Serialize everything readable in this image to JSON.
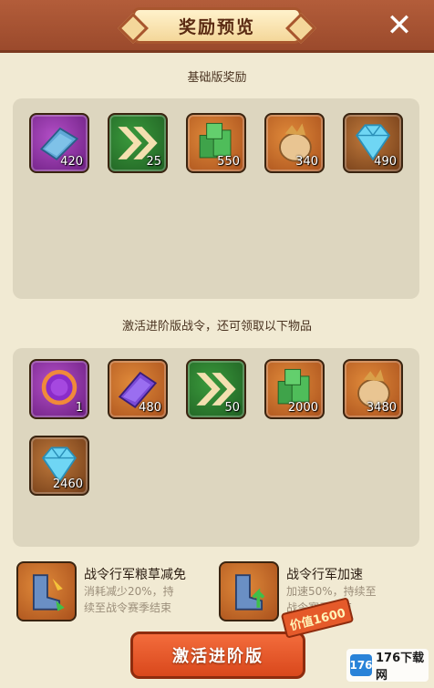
{
  "header": {
    "title": "奖励预览",
    "close_icon": "close-icon"
  },
  "basic": {
    "label": "基础版奖励",
    "items": [
      {
        "icon": "blueprint-icon",
        "qty": "420",
        "color": "purple"
      },
      {
        "icon": "speedup-arrows-icon",
        "qty": "25",
        "color": "green"
      },
      {
        "icon": "lumber-icon",
        "qty": "550",
        "color": "orange"
      },
      {
        "icon": "food-sack-icon",
        "qty": "340",
        "color": "orange"
      },
      {
        "icon": "diamond-icon",
        "qty": "490",
        "color": "brown"
      }
    ]
  },
  "advanced": {
    "label": "激活进阶版战令，还可领取以下物品",
    "items": [
      {
        "icon": "portal-ring-icon",
        "qty": "1",
        "color": "purple"
      },
      {
        "icon": "scroll-book-icon",
        "qty": "480",
        "color": "orange"
      },
      {
        "icon": "speedup-arrows-icon",
        "qty": "50",
        "color": "green"
      },
      {
        "icon": "lumber-icon",
        "qty": "2000",
        "color": "orange"
      },
      {
        "icon": "food-sack-icon",
        "qty": "3480",
        "color": "orange"
      },
      {
        "icon": "diamond-icon",
        "qty": "2460",
        "color": "brown"
      }
    ]
  },
  "perks": [
    {
      "icon": "boot-grain-icon",
      "title": "战令行军粮草减免",
      "desc1": "消耗减少20%，持",
      "desc2": "续至战令赛季结束"
    },
    {
      "icon": "boot-speed-icon",
      "title": "战令行军加速",
      "desc1": "加速50%，持续至",
      "desc2": "战令赛季结束"
    }
  ],
  "activate_button": "激活进阶版",
  "price_tag": "价值1600",
  "watermark": {
    "logo": "176",
    "text": "176下载网"
  }
}
